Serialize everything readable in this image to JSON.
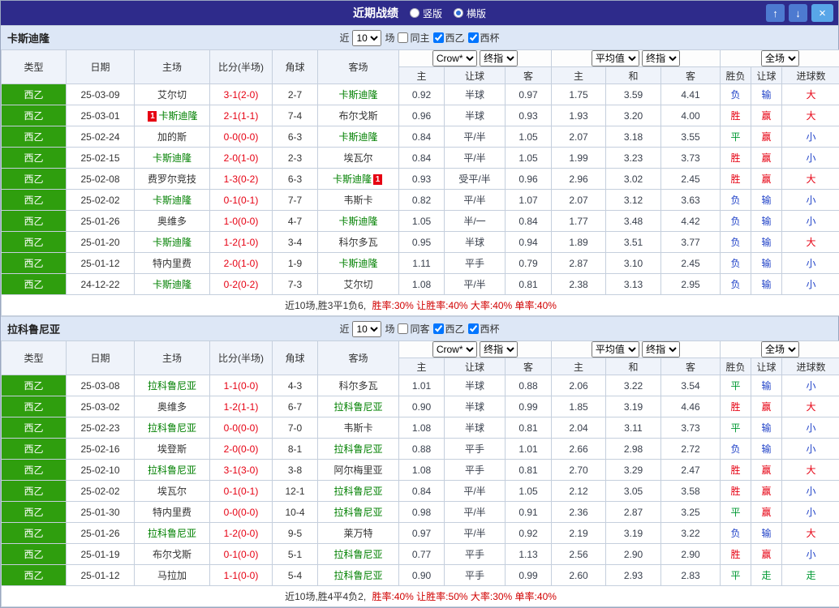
{
  "titlebar": {
    "title": "近期战绩",
    "vertical_label": "竖版",
    "horizontal_label": "横版",
    "selected_layout": "横版",
    "up_icon": "↑",
    "down_icon": "↓",
    "close_icon": "×",
    "bg_color": "#2e2b8b"
  },
  "filters": {
    "near_label": "近",
    "count_value": "10",
    "games_label": "场",
    "league_a": "西乙",
    "league_b": "西杯",
    "same_checked": false,
    "league_a_checked": true,
    "league_b_checked": true
  },
  "head": {
    "type": "类型",
    "date": "日期",
    "home": "主场",
    "score": "比分(半场)",
    "corner": "角球",
    "away": "客场",
    "company": "Crow*",
    "final1": "终指",
    "average": "平均值",
    "final2": "终指",
    "scope": "全场",
    "o_home": "主",
    "o_let": "让球",
    "o_away": "客",
    "a_home": "主",
    "a_draw": "和",
    "a_away": "客",
    "r_result": "胜负",
    "r_let": "让球",
    "r_goal": "进球数"
  },
  "colors": {
    "win": "#e60012",
    "lose": "#2143c8",
    "draw": "#009933",
    "focus_team": "#008000",
    "score": "#e60012",
    "league_bg": "#2f9e0e"
  },
  "sections": [
    {
      "team": "卡斯迪隆",
      "same_label": "同主",
      "rows": [
        {
          "league": "西乙",
          "date": "25-03-09",
          "home": "艾尔切",
          "home_focus": false,
          "score": "3-1(2-0)",
          "corner": "2-7",
          "away": "卡斯迪隆",
          "away_focus": true,
          "odds": [
            "0.92",
            "半球",
            "0.97"
          ],
          "avg": [
            "1.75",
            "3.59",
            "4.41"
          ],
          "result": "负",
          "let": "输",
          "goal": "大"
        },
        {
          "league": "西乙",
          "date": "25-03-01",
          "home": "卡斯迪隆",
          "home_focus": true,
          "home_badge": "1",
          "home_badge_side": "left",
          "score": "2-1(1-1)",
          "corner": "7-4",
          "away": "布尔戈斯",
          "away_focus": false,
          "odds": [
            "0.96",
            "半球",
            "0.93"
          ],
          "avg": [
            "1.93",
            "3.20",
            "4.00"
          ],
          "result": "胜",
          "let": "赢",
          "goal": "大"
        },
        {
          "league": "西乙",
          "date": "25-02-24",
          "home": "加的斯",
          "home_focus": false,
          "score": "0-0(0-0)",
          "corner": "6-3",
          "away": "卡斯迪隆",
          "away_focus": true,
          "odds": [
            "0.84",
            "平/半",
            "1.05"
          ],
          "avg": [
            "2.07",
            "3.18",
            "3.55"
          ],
          "result": "平",
          "let": "赢",
          "goal": "小"
        },
        {
          "league": "西乙",
          "date": "25-02-15",
          "home": "卡斯迪隆",
          "home_focus": true,
          "score": "2-0(1-0)",
          "corner": "2-3",
          "away": "埃瓦尔",
          "away_focus": false,
          "odds": [
            "0.84",
            "平/半",
            "1.05"
          ],
          "avg": [
            "1.99",
            "3.23",
            "3.73"
          ],
          "result": "胜",
          "let": "赢",
          "goal": "小"
        },
        {
          "league": "西乙",
          "date": "25-02-08",
          "home": "费罗尔竞技",
          "home_focus": false,
          "score": "1-3(0-2)",
          "corner": "6-3",
          "away": "卡斯迪隆",
          "away_focus": true,
          "away_badge": "1",
          "away_badge_side": "right",
          "odds": [
            "0.93",
            "受平/半",
            "0.96"
          ],
          "avg": [
            "2.96",
            "3.02",
            "2.45"
          ],
          "result": "胜",
          "let": "赢",
          "goal": "大"
        },
        {
          "league": "西乙",
          "date": "25-02-02",
          "home": "卡斯迪隆",
          "home_focus": true,
          "score": "0-1(0-1)",
          "corner": "7-7",
          "away": "韦斯卡",
          "away_focus": false,
          "odds": [
            "0.82",
            "平/半",
            "1.07"
          ],
          "avg": [
            "2.07",
            "3.12",
            "3.63"
          ],
          "result": "负",
          "let": "输",
          "goal": "小"
        },
        {
          "league": "西乙",
          "date": "25-01-26",
          "home": "奥维多",
          "home_focus": false,
          "score": "1-0(0-0)",
          "corner": "4-7",
          "away": "卡斯迪隆",
          "away_focus": true,
          "odds": [
            "1.05",
            "半/一",
            "0.84"
          ],
          "avg": [
            "1.77",
            "3.48",
            "4.42"
          ],
          "result": "负",
          "let": "输",
          "goal": "小"
        },
        {
          "league": "西乙",
          "date": "25-01-20",
          "home": "卡斯迪隆",
          "home_focus": true,
          "score": "1-2(1-0)",
          "corner": "3-4",
          "away": "科尔多瓦",
          "away_focus": false,
          "odds": [
            "0.95",
            "半球",
            "0.94"
          ],
          "avg": [
            "1.89",
            "3.51",
            "3.77"
          ],
          "result": "负",
          "let": "输",
          "goal": "大"
        },
        {
          "league": "西乙",
          "date": "25-01-12",
          "home": "特内里费",
          "home_focus": false,
          "score": "2-0(1-0)",
          "corner": "1-9",
          "away": "卡斯迪隆",
          "away_focus": true,
          "odds": [
            "1.11",
            "平手",
            "0.79"
          ],
          "avg": [
            "2.87",
            "3.10",
            "2.45"
          ],
          "result": "负",
          "let": "输",
          "goal": "小"
        },
        {
          "league": "西乙",
          "date": "24-12-22",
          "home": "卡斯迪隆",
          "home_focus": true,
          "score": "0-2(0-2)",
          "corner": "7-3",
          "away": "艾尔切",
          "away_focus": false,
          "odds": [
            "1.08",
            "平/半",
            "0.81"
          ],
          "avg": [
            "2.38",
            "3.13",
            "2.95"
          ],
          "result": "负",
          "let": "输",
          "goal": "小"
        }
      ],
      "summary": {
        "record": "近10场,胜3平1负6,",
        "stats": "胜率:30% 让胜率:40% 大率:40% 单率:40%"
      }
    },
    {
      "team": "拉科鲁尼亚",
      "same_label": "同客",
      "rows": [
        {
          "league": "西乙",
          "date": "25-03-08",
          "home": "拉科鲁尼亚",
          "home_focus": true,
          "score": "1-1(0-0)",
          "corner": "4-3",
          "away": "科尔多瓦",
          "away_focus": false,
          "odds": [
            "1.01",
            "半球",
            "0.88"
          ],
          "avg": [
            "2.06",
            "3.22",
            "3.54"
          ],
          "result": "平",
          "let": "输",
          "goal": "小"
        },
        {
          "league": "西乙",
          "date": "25-03-02",
          "home": "奥维多",
          "home_focus": false,
          "score": "1-2(1-1)",
          "corner": "6-7",
          "away": "拉科鲁尼亚",
          "away_focus": true,
          "odds": [
            "0.90",
            "半球",
            "0.99"
          ],
          "avg": [
            "1.85",
            "3.19",
            "4.46"
          ],
          "result": "胜",
          "let": "赢",
          "goal": "大"
        },
        {
          "league": "西乙",
          "date": "25-02-23",
          "home": "拉科鲁尼亚",
          "home_focus": true,
          "score": "0-0(0-0)",
          "corner": "7-0",
          "away": "韦斯卡",
          "away_focus": false,
          "odds": [
            "1.08",
            "半球",
            "0.81"
          ],
          "avg": [
            "2.04",
            "3.11",
            "3.73"
          ],
          "result": "平",
          "let": "输",
          "goal": "小"
        },
        {
          "league": "西乙",
          "date": "25-02-16",
          "home": "埃登斯",
          "home_focus": false,
          "score": "2-0(0-0)",
          "corner": "8-1",
          "away": "拉科鲁尼亚",
          "away_focus": true,
          "odds": [
            "0.88",
            "平手",
            "1.01"
          ],
          "avg": [
            "2.66",
            "2.98",
            "2.72"
          ],
          "result": "负",
          "let": "输",
          "goal": "小"
        },
        {
          "league": "西乙",
          "date": "25-02-10",
          "home": "拉科鲁尼亚",
          "home_focus": true,
          "score": "3-1(3-0)",
          "corner": "3-8",
          "away": "阿尔梅里亚",
          "away_focus": false,
          "odds": [
            "1.08",
            "平手",
            "0.81"
          ],
          "avg": [
            "2.70",
            "3.29",
            "2.47"
          ],
          "result": "胜",
          "let": "赢",
          "goal": "大"
        },
        {
          "league": "西乙",
          "date": "25-02-02",
          "home": "埃瓦尔",
          "home_focus": false,
          "score": "0-1(0-1)",
          "corner": "12-1",
          "away": "拉科鲁尼亚",
          "away_focus": true,
          "odds": [
            "0.84",
            "平/半",
            "1.05"
          ],
          "avg": [
            "2.12",
            "3.05",
            "3.58"
          ],
          "result": "胜",
          "let": "赢",
          "goal": "小"
        },
        {
          "league": "西乙",
          "date": "25-01-30",
          "home": "特内里费",
          "home_focus": false,
          "score": "0-0(0-0)",
          "corner": "10-4",
          "away": "拉科鲁尼亚",
          "away_focus": true,
          "odds": [
            "0.98",
            "平/半",
            "0.91"
          ],
          "avg": [
            "2.36",
            "2.87",
            "3.25"
          ],
          "result": "平",
          "let": "赢",
          "goal": "小"
        },
        {
          "league": "西乙",
          "date": "25-01-26",
          "home": "拉科鲁尼亚",
          "home_focus": true,
          "score": "1-2(0-0)",
          "corner": "9-5",
          "away": "莱万特",
          "away_focus": false,
          "odds": [
            "0.97",
            "平/半",
            "0.92"
          ],
          "avg": [
            "2.19",
            "3.19",
            "3.22"
          ],
          "result": "负",
          "let": "输",
          "goal": "大"
        },
        {
          "league": "西乙",
          "date": "25-01-19",
          "home": "布尔戈斯",
          "home_focus": false,
          "score": "0-1(0-0)",
          "corner": "5-1",
          "away": "拉科鲁尼亚",
          "away_focus": true,
          "odds": [
            "0.77",
            "平手",
            "1.13"
          ],
          "avg": [
            "2.56",
            "2.90",
            "2.90"
          ],
          "result": "胜",
          "let": "赢",
          "goal": "小"
        },
        {
          "league": "西乙",
          "date": "25-01-12",
          "home": "马拉加",
          "home_focus": false,
          "score": "1-1(0-0)",
          "corner": "5-4",
          "away": "拉科鲁尼亚",
          "away_focus": true,
          "odds": [
            "0.90",
            "平手",
            "0.99"
          ],
          "avg": [
            "2.60",
            "2.93",
            "2.83"
          ],
          "result": "平",
          "let": "走",
          "goal": "走"
        }
      ],
      "summary": {
        "record": "近10场,胜4平4负2,",
        "stats": "胜率:40% 让胜率:50% 大率:30% 单率:40%"
      }
    }
  ]
}
